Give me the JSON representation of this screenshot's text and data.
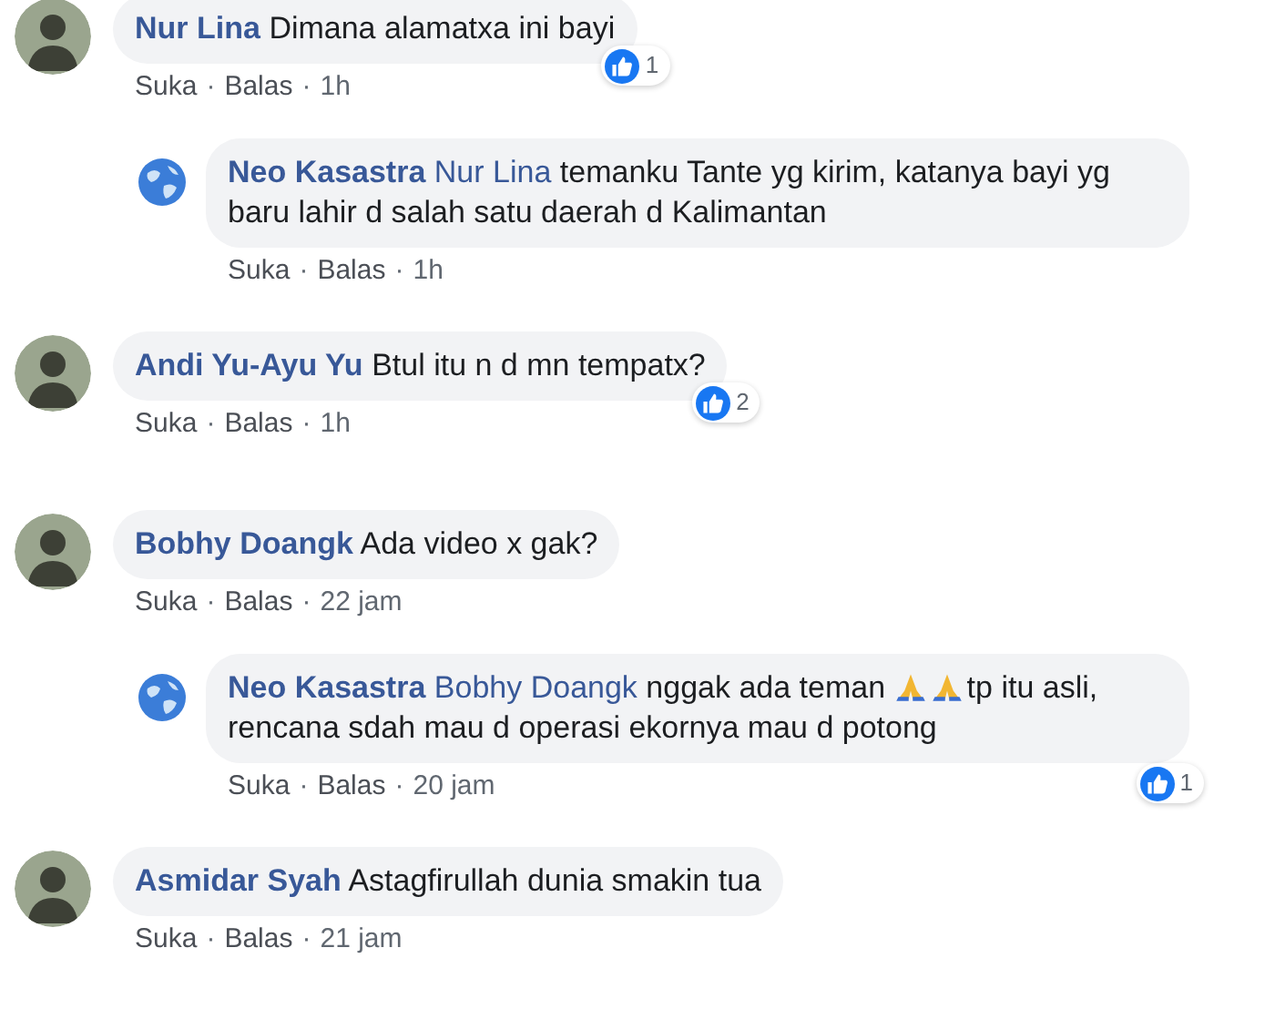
{
  "comments": [
    {
      "author": "Nur Lina",
      "avatar": {
        "kind": "photo"
      },
      "body": [
        {
          "kind": "text",
          "text": "Dimana alamatxa ini bayi"
        }
      ],
      "actions": [
        "Suka",
        "·",
        "Balas",
        "·",
        "1h"
      ],
      "reactions": "1",
      "replies": [
        {
          "author": "Neo Kasastra",
          "avatar": {
            "kind": "globe"
          },
          "body": [
            {
              "kind": "mention",
              "text": "Nur Lina"
            },
            {
              "kind": "text",
              "text": "temanku Tante yg kirim, katanya bayi yg baru lahir d salah satu daerah d Kalimantan"
            }
          ],
          "actions": [
            "Suka",
            "·",
            "Balas",
            "·",
            "1h"
          ]
        }
      ]
    },
    {
      "author": "Andi Yu-Ayu Yu",
      "avatar": {
        "kind": "photo"
      },
      "body": [
        {
          "kind": "text",
          "text": "Btul itu n d mn tempatx?"
        }
      ],
      "actions": [
        "Suka",
        "·",
        "Balas",
        "·",
        "1h"
      ],
      "reactions": "2"
    },
    {
      "author": "Bobhy Doangk",
      "avatar": {
        "kind": "photo"
      },
      "body": [
        {
          "kind": "text",
          "text": "Ada video x gak?"
        }
      ],
      "actions": [
        "Suka",
        "·",
        "Balas",
        "·",
        "22 jam"
      ],
      "replies": [
        {
          "author": "Neo Kasastra",
          "avatar": {
            "kind": "globe"
          },
          "body": [
            {
              "kind": "mention",
              "text": "Bobhy Doangk"
            },
            {
              "kind": "text",
              "text": "nggak ada teman"
            },
            {
              "kind": "emoji"
            },
            {
              "kind": "emoji"
            },
            {
              "kind": "text",
              "text": "tp itu asli, rencana sdah mau d operasi ekornya mau d potong"
            }
          ],
          "actions": [
            "Suka",
            "·",
            "Balas",
            "·",
            "20 jam"
          ],
          "reactions": "1"
        }
      ]
    },
    {
      "author": "Asmidar Syah",
      "avatar": {
        "kind": "photo"
      },
      "body": [
        {
          "kind": "text",
          "text": "Astagfirullah dunia smakin tua"
        }
      ],
      "actions": [
        "Suka",
        "·",
        "Balas",
        "·",
        "21 jam"
      ]
    }
  ]
}
